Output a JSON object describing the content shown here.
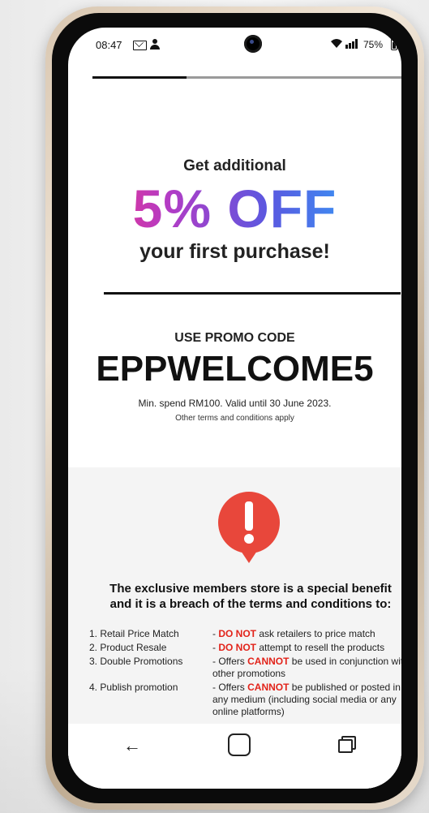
{
  "status_bar": {
    "time": "08:47",
    "battery": "75%"
  },
  "progress": {
    "fraction": 0.3
  },
  "promo": {
    "line1": "Get additional",
    "discount": "5% OFF",
    "line2": "your first purchase!",
    "code_label": "USE PROMO CODE",
    "code": "EPPWELCOME5",
    "min_spend": "Min. spend RM100. Valid until 30 June 2023.",
    "terms": "Other terms and conditions apply"
  },
  "warning": {
    "title_line1": "The exclusive members store is a special benefit",
    "title_line2": "and it is a breach of the terms and conditions to:",
    "rules": [
      {
        "name": "1. Retail Price Match",
        "prefix": "- ",
        "highlight": "DO NOT",
        "rest": " ask retailers to price match"
      },
      {
        "name": "2. Product Resale",
        "prefix": "- ",
        "highlight": "DO NOT",
        "rest": " attempt to resell the products"
      },
      {
        "name": "3. Double Promotions",
        "prefix": "- Offers ",
        "highlight": "CANNOT",
        "rest": " be used in conjunction with other promotions"
      },
      {
        "name": "4. Publish promotion",
        "prefix": "- Offers ",
        "highlight": "CANNOT",
        "rest": " be published or posted in any medium (including social media or any online platforms)"
      }
    ]
  },
  "nav": {
    "back_icon": "back-arrow-icon",
    "home_icon": "home-icon",
    "recents_icon": "recent-apps-icon"
  },
  "colors": {
    "accent_red": "#e2231a",
    "offer_gradient": [
      "#ff2f7a",
      "#b33cc5",
      "#5a58e0",
      "#28b4ff"
    ],
    "phone_frame": "#d9c7b1"
  }
}
